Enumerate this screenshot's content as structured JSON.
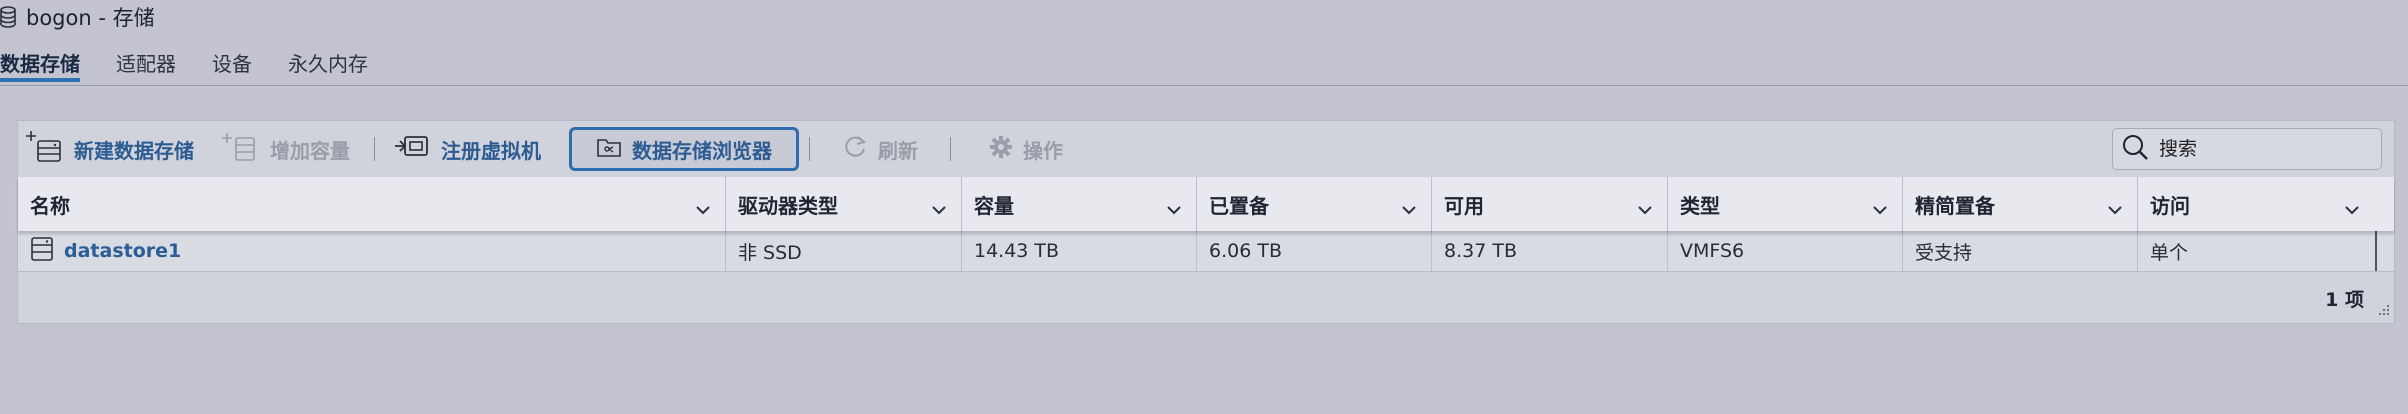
{
  "window": {
    "title": "bogon - 存储",
    "title_icon": "database-icon"
  },
  "tabs": [
    {
      "label": "数据存储",
      "active": true
    },
    {
      "label": "适配器",
      "active": false
    },
    {
      "label": "设备",
      "active": false
    },
    {
      "label": "永久内存",
      "active": false
    }
  ],
  "toolbar": {
    "new_datastore": "新建数据存储",
    "increase_capacity": "增加容量",
    "register_vm": "注册虚拟机",
    "datastore_browser": "数据存储浏览器",
    "refresh": "刷新",
    "actions": "操作",
    "search_placeholder": "搜索"
  },
  "table": {
    "columns": [
      "名称",
      "驱动器类型",
      "容量",
      "已置备",
      "可用",
      "类型",
      "精简置备",
      "访问"
    ],
    "rows": [
      {
        "name": "datastore1",
        "drive_type": "非 SSD",
        "capacity": "14.43 TB",
        "provisioned": "6.06 TB",
        "free": "8.37 TB",
        "type": "VMFS6",
        "thin": "受支持",
        "access": "单个"
      }
    ],
    "count_label": "1 项"
  },
  "colors": {
    "background": "#c3c4d0",
    "accent": "#2f6fb3",
    "link": "#2b5e97",
    "disabled": "#9a9da8"
  }
}
